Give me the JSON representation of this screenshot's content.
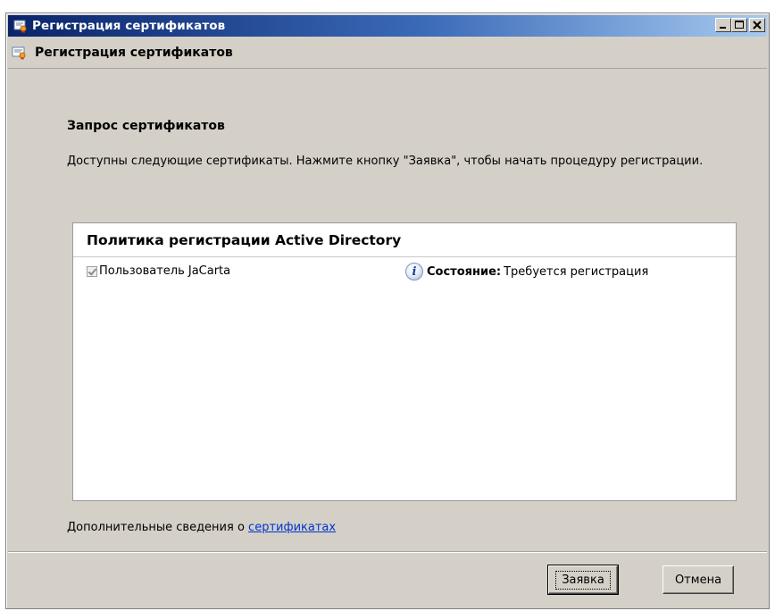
{
  "window": {
    "title": "Регистрация сертификатов",
    "controls": {
      "minimize": "_",
      "maximize": "□",
      "close": "×"
    }
  },
  "header": {
    "title": "Регистрация сертификатов"
  },
  "main": {
    "section_title": "Запрос сертификатов",
    "description": "Доступны следующие сертификаты. Нажмите кнопку \"Заявка\", чтобы начать процедуру регистрации.",
    "policy": {
      "title": "Политика регистрации Active Directory",
      "items": [
        {
          "name": "Пользователь JaCarta",
          "checked": true,
          "status_label": "Состояние:",
          "status_value": "Требуется регистрация",
          "status_icon": "info-icon"
        }
      ]
    },
    "more_info_prefix": "Дополнительные сведения о ",
    "more_info_link": "сертификатах"
  },
  "buttons": {
    "enroll": "Заявка",
    "cancel": "Отмена"
  },
  "colors": {
    "title_start": "#0a246a",
    "title_end": "#a6caf0",
    "link": "#0033cc",
    "face": "#d4d0c8"
  }
}
